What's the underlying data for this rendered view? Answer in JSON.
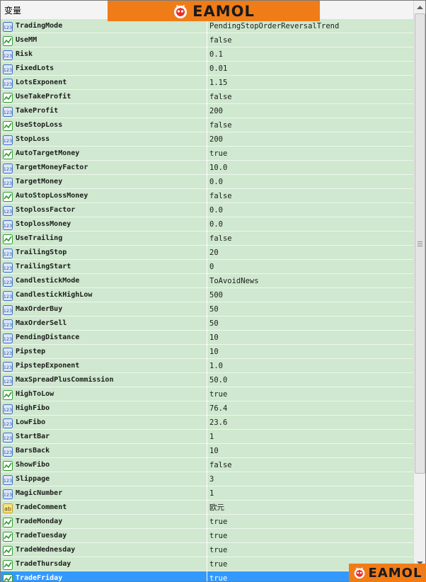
{
  "header": {
    "title": "变量"
  },
  "logo": {
    "text": "EAMOL"
  },
  "colors": {
    "row_bg": "#cfe8cf",
    "selected_bg": "#3399ff",
    "logo_bg": "#f07c18",
    "icon_num": "#3d6fc6",
    "icon_bool": "#2f9b2f",
    "icon_text": "#d4a017"
  },
  "rows": [
    {
      "name": "TradingMode",
      "value": "PendingStopOrderReversalTrend",
      "type": "num",
      "icon": "number-icon"
    },
    {
      "name": "UseMM",
      "value": "false",
      "type": "bool",
      "icon": "boolean-icon"
    },
    {
      "name": "Risk",
      "value": "0.1",
      "type": "num",
      "icon": "number-icon"
    },
    {
      "name": "FixedLots",
      "value": "0.01",
      "type": "num",
      "icon": "number-icon"
    },
    {
      "name": "LotsExponent",
      "value": "1.15",
      "type": "num",
      "icon": "number-icon"
    },
    {
      "name": "UseTakeProfit",
      "value": "false",
      "type": "bool",
      "icon": "boolean-icon"
    },
    {
      "name": "TakeProfit",
      "value": "200",
      "type": "num",
      "icon": "number-icon"
    },
    {
      "name": "UseStopLoss",
      "value": "false",
      "type": "bool",
      "icon": "boolean-icon"
    },
    {
      "name": "StopLoss",
      "value": "200",
      "type": "num",
      "icon": "number-icon"
    },
    {
      "name": "AutoTargetMoney",
      "value": "true",
      "type": "bool",
      "icon": "boolean-icon"
    },
    {
      "name": "TargetMoneyFactor",
      "value": "10.0",
      "type": "num",
      "icon": "number-icon"
    },
    {
      "name": "TargetMoney",
      "value": "0.0",
      "type": "num",
      "icon": "number-icon"
    },
    {
      "name": "AutoStopLossMoney",
      "value": "false",
      "type": "bool",
      "icon": "boolean-icon"
    },
    {
      "name": "StoplossFactor",
      "value": "0.0",
      "type": "num",
      "icon": "number-icon"
    },
    {
      "name": "StoplossMoney",
      "value": "0.0",
      "type": "num",
      "icon": "number-icon"
    },
    {
      "name": "UseTrailing",
      "value": "false",
      "type": "bool",
      "icon": "boolean-icon"
    },
    {
      "name": "TrailingStop",
      "value": "20",
      "type": "num",
      "icon": "number-icon"
    },
    {
      "name": "TrailingStart",
      "value": "0",
      "type": "num",
      "icon": "number-icon"
    },
    {
      "name": "CandlestickMode",
      "value": "ToAvoidNews",
      "type": "num",
      "icon": "number-icon"
    },
    {
      "name": "CandlestickHighLow",
      "value": "500",
      "type": "num",
      "icon": "number-icon"
    },
    {
      "name": "MaxOrderBuy",
      "value": "50",
      "type": "num",
      "icon": "number-icon"
    },
    {
      "name": "MaxOrderSell",
      "value": "50",
      "type": "num",
      "icon": "number-icon"
    },
    {
      "name": "PendingDistance",
      "value": "10",
      "type": "num",
      "icon": "number-icon"
    },
    {
      "name": "Pipstep",
      "value": "10",
      "type": "num",
      "icon": "number-icon"
    },
    {
      "name": "PipstepExponent",
      "value": "1.0",
      "type": "num",
      "icon": "number-icon"
    },
    {
      "name": "MaxSpreadPlusCommission",
      "value": "50.0",
      "type": "num",
      "icon": "number-icon"
    },
    {
      "name": "HighToLow",
      "value": "true",
      "type": "bool",
      "icon": "boolean-icon"
    },
    {
      "name": "HighFibo",
      "value": "76.4",
      "type": "num",
      "icon": "number-icon"
    },
    {
      "name": "LowFibo",
      "value": "23.6",
      "type": "num",
      "icon": "number-icon"
    },
    {
      "name": "StartBar",
      "value": "1",
      "type": "num",
      "icon": "number-icon"
    },
    {
      "name": "BarsBack",
      "value": "10",
      "type": "num",
      "icon": "number-icon"
    },
    {
      "name": "ShowFibo",
      "value": "false",
      "type": "bool",
      "icon": "boolean-icon"
    },
    {
      "name": "Slippage",
      "value": "3",
      "type": "num",
      "icon": "number-icon"
    },
    {
      "name": "MagicNumber",
      "value": "1",
      "type": "num",
      "icon": "number-icon"
    },
    {
      "name": "TradeComment",
      "value": "欧元",
      "type": "text",
      "icon": "text-icon"
    },
    {
      "name": "TradeMonday",
      "value": "true",
      "type": "bool",
      "icon": "boolean-icon"
    },
    {
      "name": "TradeTuesday",
      "value": "true",
      "type": "bool",
      "icon": "boolean-icon"
    },
    {
      "name": "TradeWednesday",
      "value": "true",
      "type": "bool",
      "icon": "boolean-icon"
    },
    {
      "name": "TradeThursday",
      "value": "true",
      "type": "bool",
      "icon": "boolean-icon"
    },
    {
      "name": "TradeFriday",
      "value": "true",
      "type": "bool",
      "icon": "boolean-icon",
      "selected": true
    }
  ]
}
